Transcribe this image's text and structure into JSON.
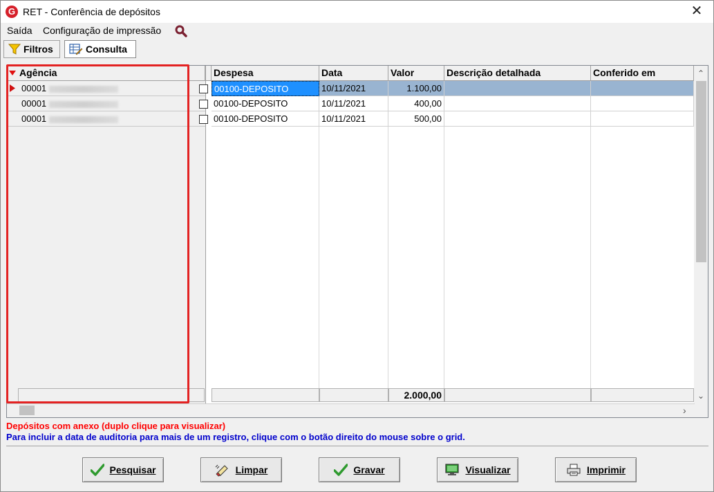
{
  "window": {
    "title": "RET - Conferência de depósitos",
    "app_icon": "G"
  },
  "menu": {
    "items": [
      "Saída",
      "Configuração de impressão"
    ]
  },
  "toolbar": {
    "filtros_label": "Filtros",
    "consulta_label": "Consulta"
  },
  "grid": {
    "left_header": "Agência",
    "columns": [
      "Despesa",
      "Data",
      "Valor",
      "Descrição detalhada",
      "Conferido em"
    ],
    "rows": [
      {
        "agencia": "00001",
        "despesa": "00100-DEPOSITO",
        "data": "10/11/2021",
        "valor": "1.100,00",
        "descricao": "",
        "conferido": ""
      },
      {
        "agencia": "00001",
        "despesa": "00100-DEPOSITO",
        "data": "10/11/2021",
        "valor": "400,00",
        "descricao": "",
        "conferido": ""
      },
      {
        "agencia": "00001",
        "despesa": "00100-DEPOSITO",
        "data": "10/11/2021",
        "valor": "500,00",
        "descricao": "",
        "conferido": ""
      }
    ],
    "total": "2.000,00"
  },
  "messages": {
    "anexo": "Depósitos com anexo (duplo clique para visualizar)",
    "auditoria": "Para incluir a data de auditoria para mais de um registro, clique com o botão direito do mouse sobre o grid."
  },
  "buttons": {
    "pesquisar": "Pesquisar",
    "limpar": "Limpar",
    "gravar": "Gravar",
    "visualizar": "Visualizar",
    "imprimir": "Imprimir"
  },
  "colors": {
    "selection": "#99b4d1",
    "highlight_box": "#e32222",
    "anexo_text": "#ff0000",
    "auditoria_text": "#0000cc"
  }
}
